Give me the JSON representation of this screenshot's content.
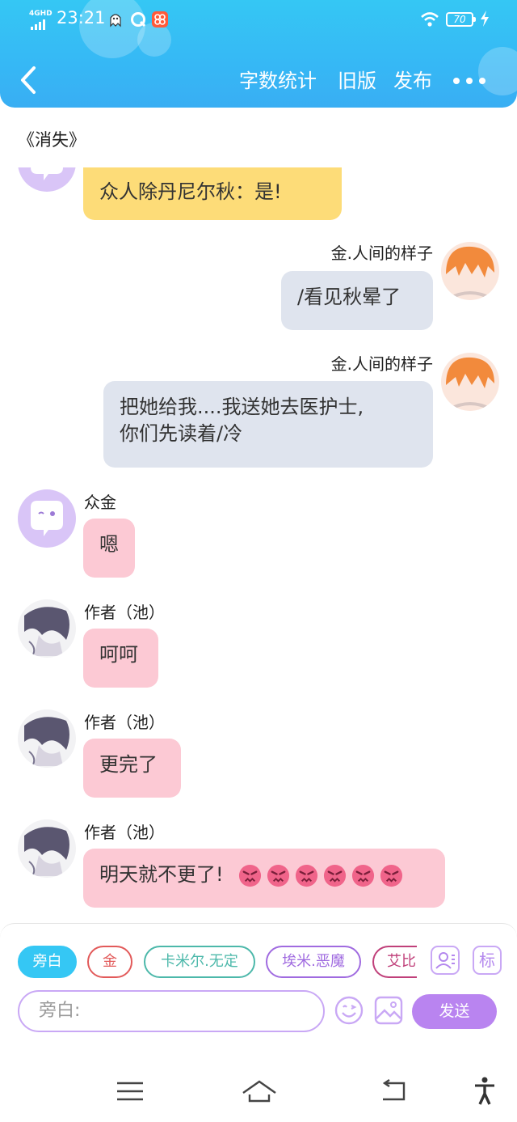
{
  "status_bar": {
    "network": "4GHD",
    "time": "23:21",
    "battery": "70"
  },
  "nav": {
    "word_count": "字数统计",
    "old_version": "旧版",
    "publish": "发布"
  },
  "doc_title": "《消失》",
  "messages": [
    {
      "sender": "",
      "text": "众人除丹尼尔秋：是!"
    },
    {
      "sender": "金.人间的样子",
      "text": "/看见秋晕了"
    },
    {
      "sender": "金.人间的样子",
      "lines": [
        "把她给我....我送她去医护士,",
        "你们先读着/冷"
      ]
    },
    {
      "sender": "众金",
      "text": "嗯"
    },
    {
      "sender": "作者（池）",
      "text": "呵呵"
    },
    {
      "sender": "作者（池）",
      "text": "更完了"
    },
    {
      "sender": "作者（池）",
      "text": "明天就不更了!"
    }
  ],
  "composer": {
    "chips": [
      {
        "label": "旁白",
        "color": "#35c7f4"
      },
      {
        "label": "金",
        "color": "#e25a5a"
      },
      {
        "label": "卡米尔.无定",
        "color": "#4cb8aa"
      },
      {
        "label": "埃米.恶魔",
        "color": "#a06be0"
      },
      {
        "label": "艾比",
        "color": "#c0407a"
      }
    ],
    "tag_label": "标",
    "placeholder": "旁白:",
    "send_label": "发送"
  }
}
